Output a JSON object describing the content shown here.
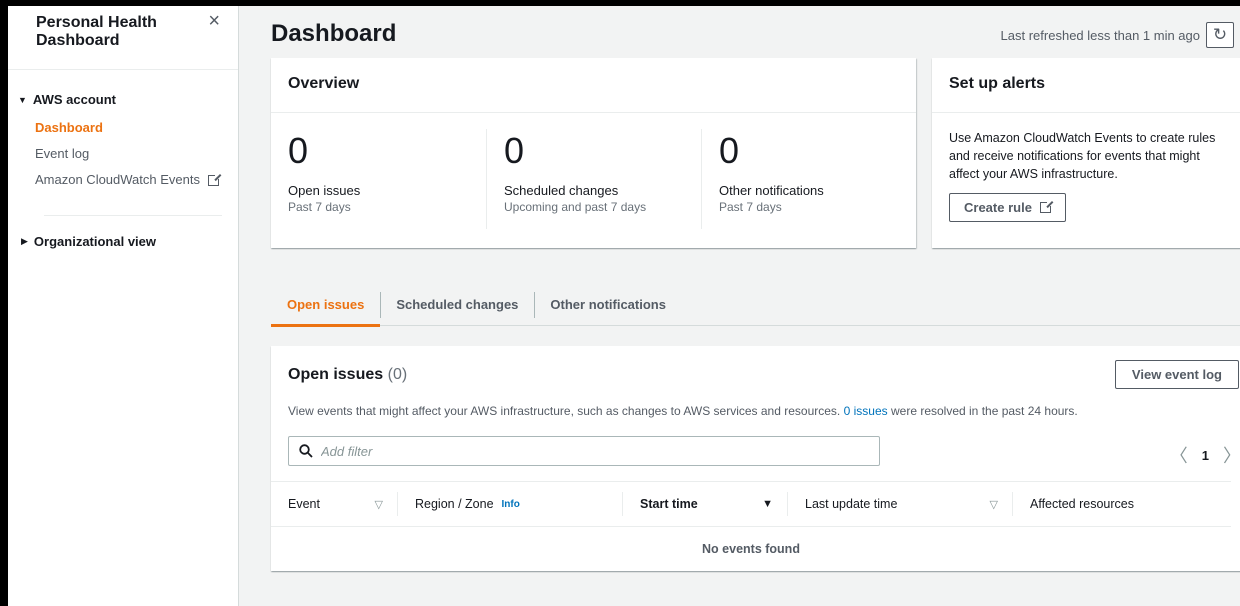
{
  "sidebar": {
    "title": "Personal Health Dashboard",
    "close_icon": "×",
    "section_aws": "AWS account",
    "items": [
      {
        "label": "Dashboard"
      },
      {
        "label": "Event log"
      },
      {
        "label": "Amazon CloudWatch Events"
      }
    ],
    "section_org": "Organizational view"
  },
  "header": {
    "title": "Dashboard",
    "refresh_text": "Last refreshed less than 1 min ago",
    "refresh_icon": "↻"
  },
  "overview": {
    "title": "Overview",
    "stats": [
      {
        "value": "0",
        "label": "Open issues",
        "sub": "Past 7 days"
      },
      {
        "value": "0",
        "label": "Scheduled changes",
        "sub": "Upcoming and past 7 days"
      },
      {
        "value": "0",
        "label": "Other notifications",
        "sub": "Past 7 days"
      }
    ]
  },
  "alerts": {
    "title": "Set up alerts",
    "body": "Use Amazon CloudWatch Events to create rules and receive notifications for events that might affect your AWS infrastructure.",
    "button": "Create rule"
  },
  "tabs": [
    {
      "label": "Open issues"
    },
    {
      "label": "Scheduled changes"
    },
    {
      "label": "Other notifications"
    }
  ],
  "issues": {
    "title": "Open issues",
    "count": "(0)",
    "view_log": "View event log",
    "desc_before": "View events that might affect your AWS infrastructure, such as changes to AWS services and resources.",
    "desc_link": "0 issues",
    "desc_after": "were resolved in the past 24 hours.",
    "filter_placeholder": "Add filter",
    "page": "1",
    "columns": {
      "event": "Event",
      "region": "Region / Zone",
      "region_info": "Info",
      "start": "Start time",
      "last_update": "Last update time",
      "affected": "Affected resources"
    },
    "empty": "No events found"
  },
  "colors": {
    "accent": "#ec7211",
    "link": "#0073bb"
  }
}
